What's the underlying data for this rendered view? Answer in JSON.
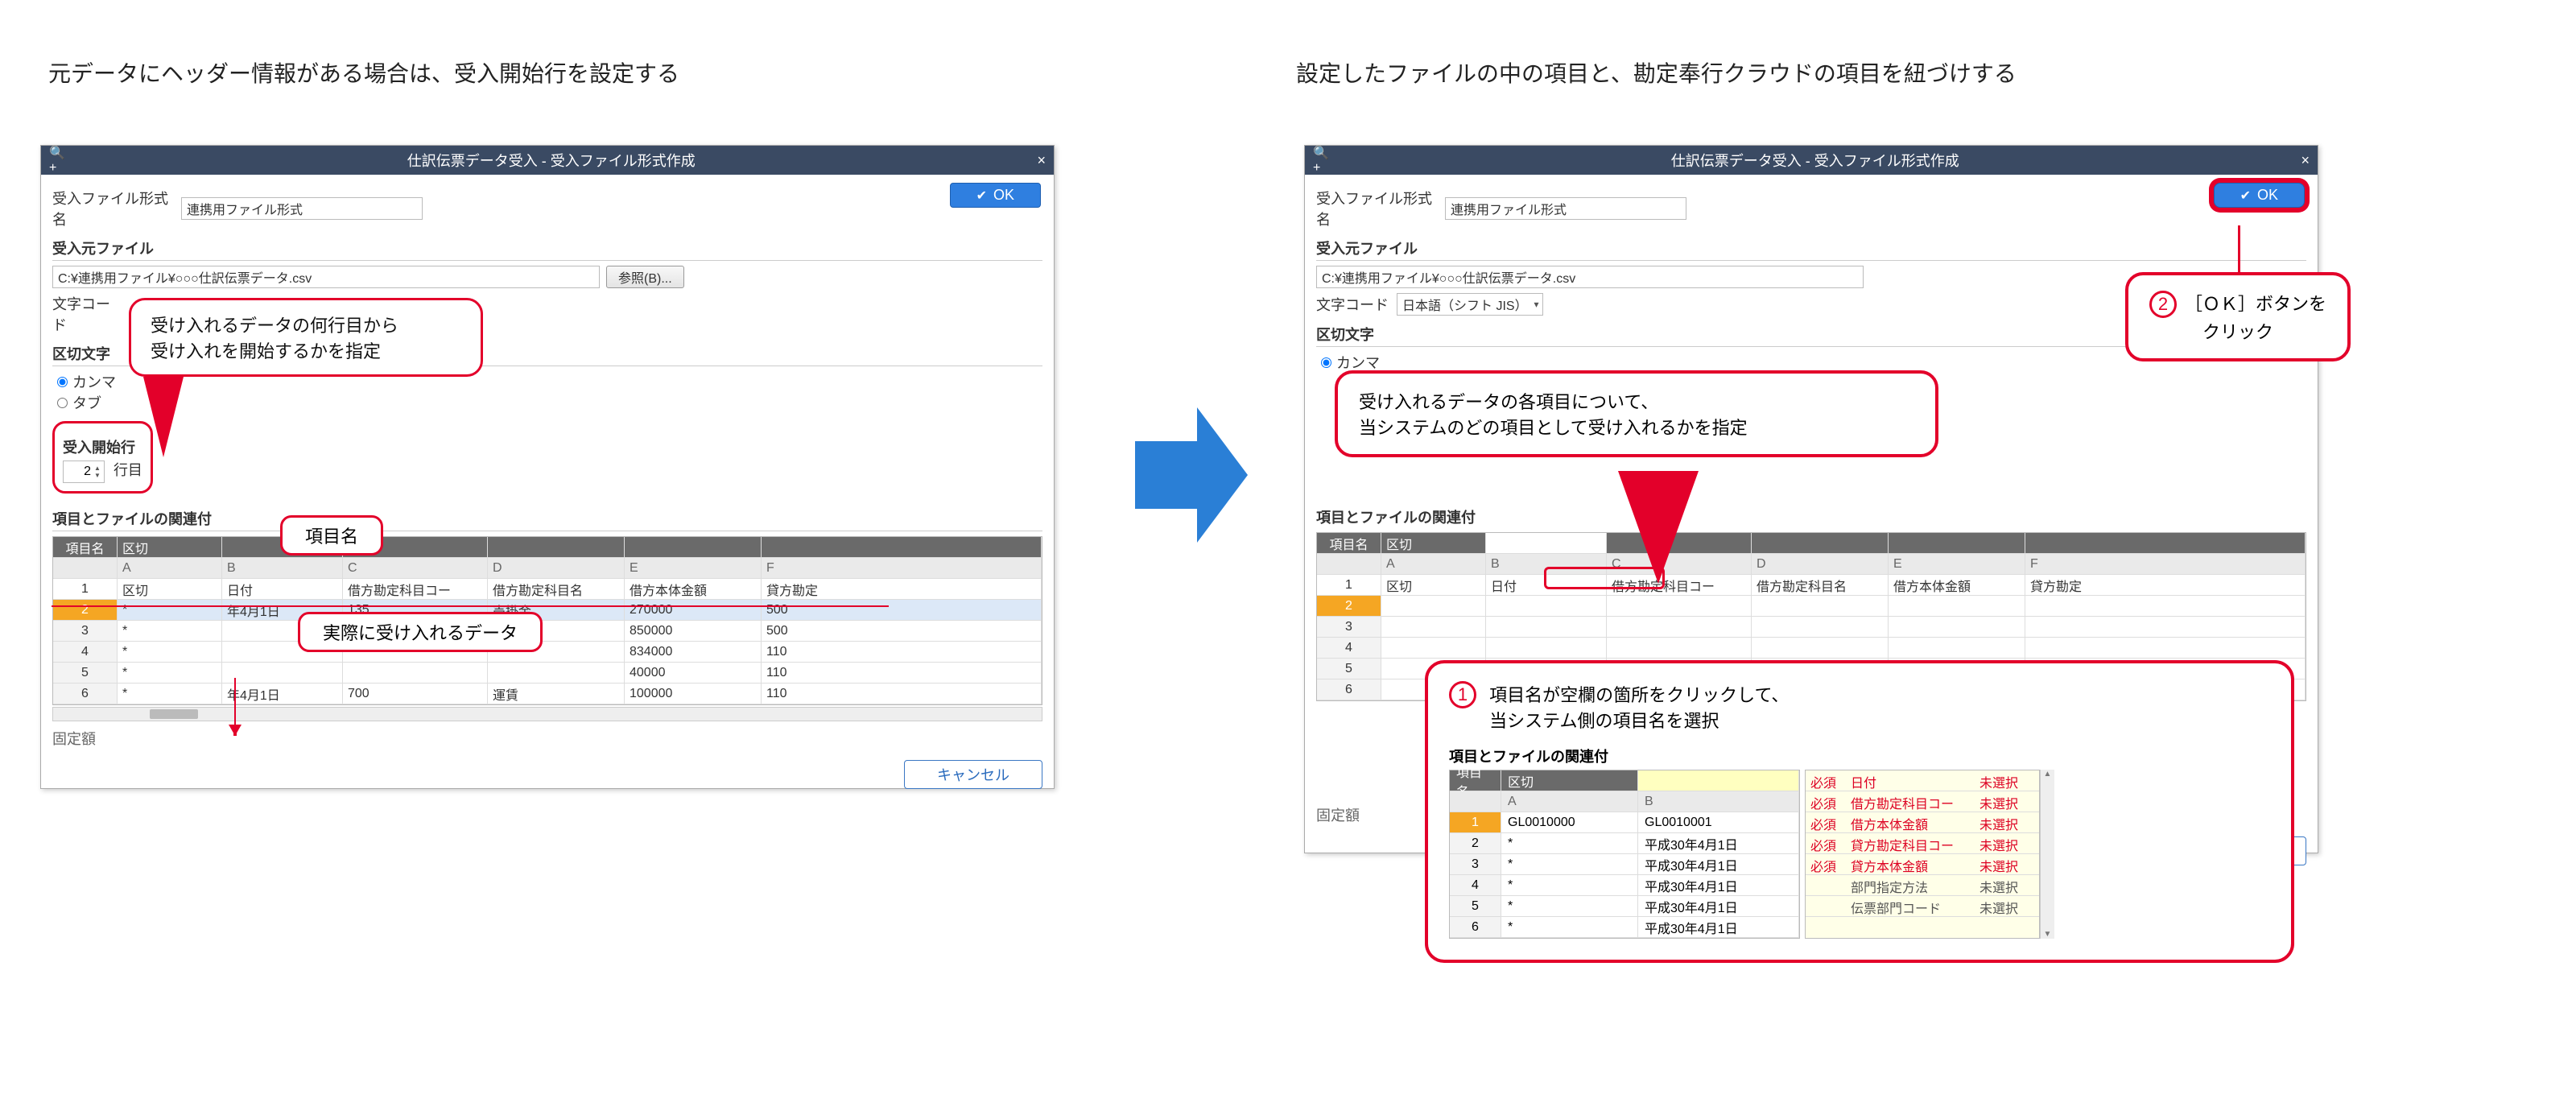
{
  "captions": {
    "left": "元データにヘッダー情報がある場合は、受入開始行を設定する",
    "right": "設定したファイルの中の項目と、勘定奉行クラウドの項目を紐づけする"
  },
  "window": {
    "title": "仕訳伝票データ受入 - 受入ファイル形式作成",
    "search_icon": "🔍+",
    "close": "×",
    "ok": "OK",
    "cancel": "キャンセル"
  },
  "file_format": {
    "label": "受入ファイル形式名",
    "value": "連携用ファイル形式"
  },
  "section": {
    "source": "受入元ファイル",
    "delimiter": "区切文字",
    "startrow": "受入開始行",
    "mapping": "項目とファイルの関連付",
    "fixed": "固定額"
  },
  "source": {
    "path": "C:¥連携用ファイル¥○○○仕訳伝票データ.csv",
    "browse": "参照(B)...",
    "charset_label": "文字コード",
    "charset_value": "日本語（シフト JIS）"
  },
  "delimiter": {
    "comma": "カンマ",
    "tab": "タブ"
  },
  "startrow": {
    "value": "2",
    "suffix": "行目"
  },
  "grid": {
    "item_label": "項目名",
    "row1": {
      "a": "区切"
    },
    "colLetters": [
      "A",
      "B",
      "C",
      "D",
      "E",
      "F"
    ],
    "headers": {
      "a": "区切",
      "b": "日付",
      "c": "借方勘定科目コー",
      "d": "借方勘定科目名",
      "e": "借方本体金額",
      "f": "貸方勘定"
    },
    "rows": [
      {
        "n": "2",
        "a": "*",
        "b": "年4月1日",
        "c": "135",
        "d": "売掛金",
        "e": "270000",
        "f": "500"
      },
      {
        "n": "3",
        "a": "*",
        "b": "",
        "c": "",
        "d": "",
        "e": "850000",
        "f": "500"
      },
      {
        "n": "4",
        "a": "*",
        "b": "",
        "c": "",
        "d": "",
        "e": "834000",
        "f": "110"
      },
      {
        "n": "5",
        "a": "*",
        "b": "",
        "c": "",
        "d": "",
        "e": "40000",
        "f": "110"
      },
      {
        "n": "6",
        "a": "*",
        "b": "年4月1日",
        "c": "700",
        "d": "運賃",
        "e": "100000",
        "f": "110"
      }
    ]
  },
  "right_grid": {
    "headers": {
      "a": "区切",
      "b": "日付",
      "c": "借方勘定科目コー",
      "d": "借方勘定科目名",
      "e": "借方本体金額",
      "f": "貸方勘定"
    },
    "rows": [
      "1",
      "2",
      "3",
      "4",
      "5",
      "6"
    ],
    "a1": "区切"
  },
  "callouts": {
    "left_main": "受け入れるデータの何行目から\n受け入れを開始するかを指定",
    "itemname": "項目名",
    "actualdata": "実際に受け入れるデータ",
    "right_main": "受け入れるデータの各項目について、\n当システムのどの項目として受け入れるかを指定",
    "zoom": "項目名が空欄の箇所をクリックして、\n当システム側の項目名を選択",
    "ok": "［ＯＫ］ボタンを\nクリック"
  },
  "badges": {
    "one": "1",
    "two": "2"
  },
  "zoom": {
    "header": "項目とファイルの関連付",
    "item_label": "項目名",
    "a_label": "区切",
    "colLetters": [
      "A",
      "B"
    ],
    "rows": [
      {
        "n": "1",
        "a": "GL0010000",
        "b": "GL0010001"
      },
      {
        "n": "2",
        "a": "*",
        "b": "平成30年4月1日"
      },
      {
        "n": "3",
        "a": "*",
        "b": "平成30年4月1日"
      },
      {
        "n": "4",
        "a": "*",
        "b": "平成30年4月1日"
      },
      {
        "n": "5",
        "a": "*",
        "b": "平成30年4月1日"
      },
      {
        "n": "6",
        "a": "*",
        "b": "平成30年4月1日"
      }
    ],
    "picklist": [
      {
        "req": "必須",
        "name": "日付",
        "state": "未選択"
      },
      {
        "req": "必須",
        "name": "借方勘定科目コー",
        "state": "未選択"
      },
      {
        "req": "必須",
        "name": "借方本体金額",
        "state": "未選択"
      },
      {
        "req": "必須",
        "name": "貸方勘定科目コー",
        "state": "未選択"
      },
      {
        "req": "必須",
        "name": "貸方本体金額",
        "state": "未選択"
      },
      {
        "req": "",
        "name": "部門指定方法",
        "state": "未選択"
      },
      {
        "req": "",
        "name": "伝票部門コード",
        "state": "未選択"
      }
    ]
  }
}
